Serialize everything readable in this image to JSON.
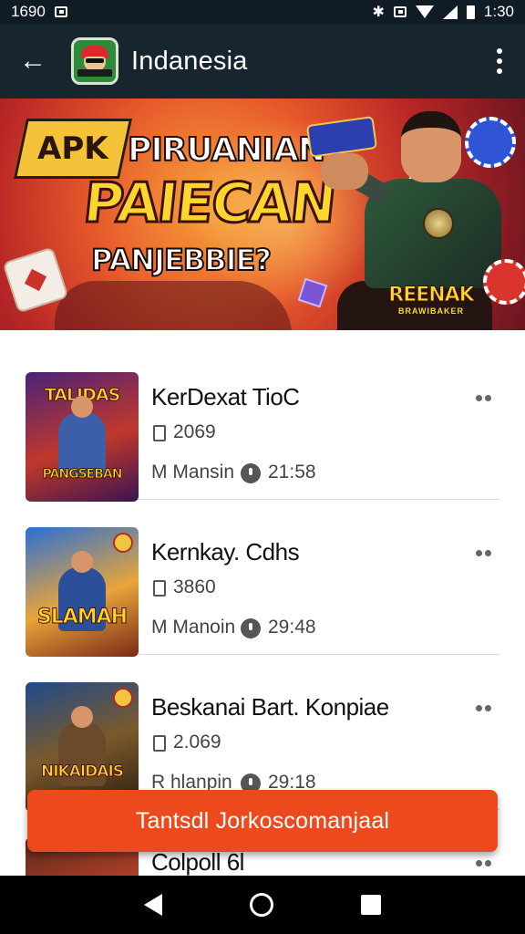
{
  "status_bar": {
    "time_left": "1690",
    "time_right": "1:30"
  },
  "app_bar": {
    "back_icon": "arrow-left-icon",
    "title": "Indanesia",
    "menu_icon": "more-vert-icon"
  },
  "banner": {
    "badge": "APK",
    "line1": "PIRUANIAN",
    "line2": "PAIECAN",
    "line3": "PANJEBBIE?",
    "brand": "REENAK",
    "brand_sub": "BRAWIBAKER"
  },
  "list": {
    "items": [
      {
        "thumb_text": "TALIDAS",
        "thumb_sub": "PANGSEBAN",
        "title": "KerDexat TioC",
        "size": "2069",
        "developer": "M Mansin",
        "time": "21:58"
      },
      {
        "thumb_text": "SLAMAH",
        "thumb_sub": "",
        "title": "Kernkay. Cdhs",
        "size": "3860",
        "developer": "M Manoin",
        "time": "29:48"
      },
      {
        "thumb_text": "NIKAIDAIS",
        "thumb_sub": "",
        "title": "Beskanai Bart. Konpiae",
        "size": "2.069",
        "developer": "R hlanpin",
        "time": "29:18"
      },
      {
        "thumb_text": "",
        "thumb_sub": "",
        "title": "Colpoll 6l",
        "size": "",
        "developer": "",
        "time": ""
      }
    ]
  },
  "cta": {
    "label": "Tantsdl Jorkoscomanjaal"
  },
  "nav": {
    "back": "nav-back-icon",
    "home": "nav-home-icon",
    "recents": "nav-recents-icon"
  },
  "colors": {
    "app_bar": "#17252f",
    "cta": "#ec4a1c",
    "status_bar": "#0f1b25"
  }
}
